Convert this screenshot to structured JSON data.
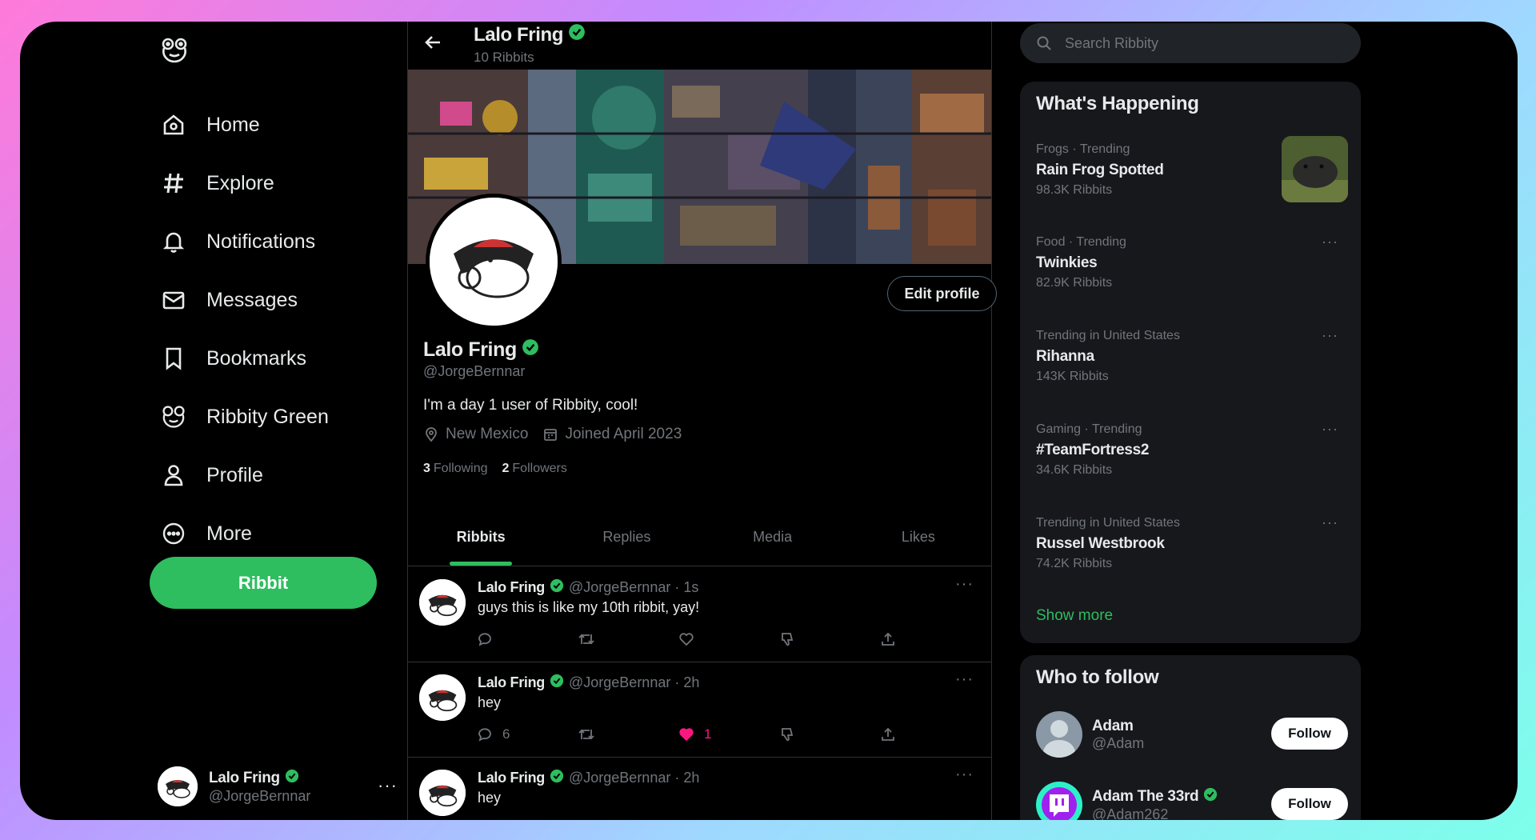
{
  "sidebar": {
    "logo": "frog-logo-icon",
    "items": [
      {
        "label": "Home",
        "icon": "home-icon"
      },
      {
        "label": "Explore",
        "icon": "hashtag-icon"
      },
      {
        "label": "Notifications",
        "icon": "bell-icon"
      },
      {
        "label": "Messages",
        "icon": "envelope-icon"
      },
      {
        "label": "Bookmarks",
        "icon": "bookmark-icon"
      },
      {
        "label": "Ribbity Green",
        "icon": "frog-icon"
      },
      {
        "label": "Profile",
        "icon": "person-icon"
      },
      {
        "label": "More",
        "icon": "more-circle-icon"
      }
    ],
    "ribbit_button": "Ribbit",
    "account": {
      "name": "Lalo Fring",
      "handle": "@JorgeBernnar",
      "menu": "···"
    }
  },
  "header": {
    "name": "Lalo Fring",
    "count": "10 Ribbits"
  },
  "profile": {
    "name": "Lalo Fring",
    "handle": "@JorgeBernnar",
    "bio": "I'm a day 1 user of Ribbity, cool!",
    "location": "New Mexico",
    "joined": "Joined April 2023",
    "following_count": "3",
    "following_label": "Following",
    "followers_count": "2",
    "followers_label": "Followers",
    "edit_button": "Edit profile"
  },
  "tabs": [
    {
      "label": "Ribbits",
      "active": true
    },
    {
      "label": "Replies",
      "active": false
    },
    {
      "label": "Media",
      "active": false
    },
    {
      "label": "Likes",
      "active": false
    }
  ],
  "posts": [
    {
      "name": "Lalo Fring",
      "meta": "@JorgeBernnar · 1s",
      "text": "guys this is like my 10th ribbit, yay!",
      "replies": "",
      "likes": "",
      "liked": false
    },
    {
      "name": "Lalo Fring",
      "meta": "@JorgeBernnar · 2h",
      "text": "hey",
      "replies": "6",
      "likes": "1",
      "liked": true
    },
    {
      "name": "Lalo Fring",
      "meta": "@JorgeBernnar · 2h",
      "text": "hey",
      "replies": "",
      "likes": "",
      "liked": false
    }
  ],
  "search": {
    "placeholder": "Search Ribbity"
  },
  "happening": {
    "title": "What's Happening",
    "trends": [
      {
        "category": "Frogs · Trending",
        "title": "Rain Frog Spotted",
        "count": "98.3K Ribbits"
      },
      {
        "category": "Food · Trending",
        "title": "Twinkies",
        "count": "82.9K Ribbits"
      },
      {
        "category": "Trending in United States",
        "title": "Rihanna",
        "count": "143K Ribbits"
      },
      {
        "category": "Gaming · Trending",
        "title": "#TeamFortress2",
        "count": "34.6K Ribbits"
      },
      {
        "category": "Trending in United States",
        "title": "Russel Westbrook",
        "count": "74.2K Ribbits"
      }
    ],
    "show_more": "Show more"
  },
  "who_to_follow": {
    "title": "Who to follow",
    "users": [
      {
        "name": "Adam",
        "handle": "@Adam",
        "button": "Follow"
      },
      {
        "name": "Adam The 33rd",
        "handle": "@Adam262",
        "button": "Follow"
      }
    ]
  },
  "colors": {
    "accent": "#2ebd5f",
    "like": "#f91880",
    "background": "#000000",
    "muted": "#71767b"
  }
}
